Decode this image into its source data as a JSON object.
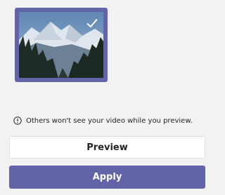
{
  "colors": {
    "accent": "#6264a7",
    "panel_background": "#f2f2f2",
    "button_background": "#ffffff",
    "text": "#252423"
  },
  "background_option": {
    "description_icon": "mountain-landscape-image",
    "selected": true,
    "selected_icon": "checkmark-icon"
  },
  "info": {
    "icon": "info-icon",
    "text": "Others won't see your video while you preview."
  },
  "buttons": {
    "preview_label": "Preview",
    "apply_label": "Apply"
  }
}
